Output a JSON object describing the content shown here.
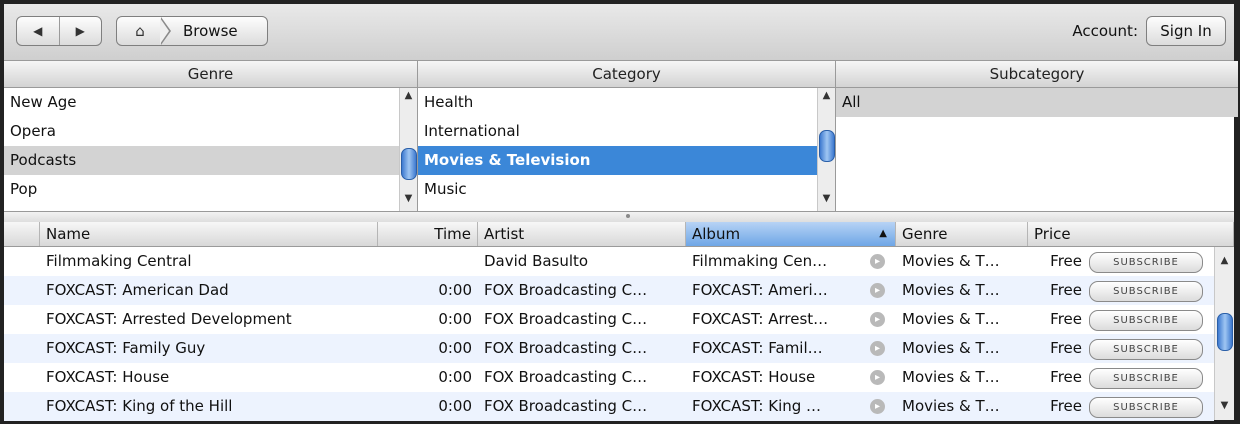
{
  "toolbar": {
    "back_icon": "◀",
    "forward_icon": "▶",
    "home_icon": "⌂",
    "breadcrumb": "Browse",
    "account_label": "Account:",
    "signin_label": "Sign In"
  },
  "browser": {
    "genre": {
      "header": "Genre",
      "items": [
        "New Age",
        "Opera",
        "Podcasts",
        "Pop"
      ],
      "selected": "Podcasts"
    },
    "category": {
      "header": "Category",
      "items": [
        "Health",
        "International",
        "Movies & Television",
        "Music"
      ],
      "selected": "Movies & Television"
    },
    "subcategory": {
      "header": "Subcategory",
      "items": [
        "All"
      ],
      "selected": "All"
    }
  },
  "table": {
    "columns": [
      "Name",
      "Time",
      "Artist",
      "Album",
      "Genre",
      "Price"
    ],
    "sorted_column": "Album",
    "subscribe_label": "SUBSCRIBE",
    "rows": [
      {
        "name": "Filmmaking Central",
        "time": "",
        "artist": "David Basulto",
        "album": "Filmmaking Cen…",
        "genre": "Movies & T…",
        "price": "Free"
      },
      {
        "name": "FOXCAST: American Dad",
        "time": "0:00",
        "artist": "FOX Broadcasting C…",
        "album": "FOXCAST: Ameri…",
        "genre": "Movies & T…",
        "price": "Free"
      },
      {
        "name": "FOXCAST: Arrested Development",
        "time": "0:00",
        "artist": "FOX Broadcasting C…",
        "album": "FOXCAST: Arrest…",
        "genre": "Movies & T…",
        "price": "Free"
      },
      {
        "name": "FOXCAST: Family Guy",
        "time": "0:00",
        "artist": "FOX Broadcasting C…",
        "album": "FOXCAST: Famil…",
        "genre": "Movies & T…",
        "price": "Free"
      },
      {
        "name": "FOXCAST: House",
        "time": "0:00",
        "artist": "FOX Broadcasting C…",
        "album": "FOXCAST: House",
        "genre": "Movies & T…",
        "price": "Free"
      },
      {
        "name": "FOXCAST: King of the Hill",
        "time": "0:00",
        "artist": "FOX Broadcasting C…",
        "album": "FOXCAST: King …",
        "genre": "Movies & T…",
        "price": "Free"
      }
    ]
  },
  "colors": {
    "selection_blue": "#3b87d8",
    "selection_gray": "#d3d3d3",
    "row_alt": "#edf3fe"
  }
}
